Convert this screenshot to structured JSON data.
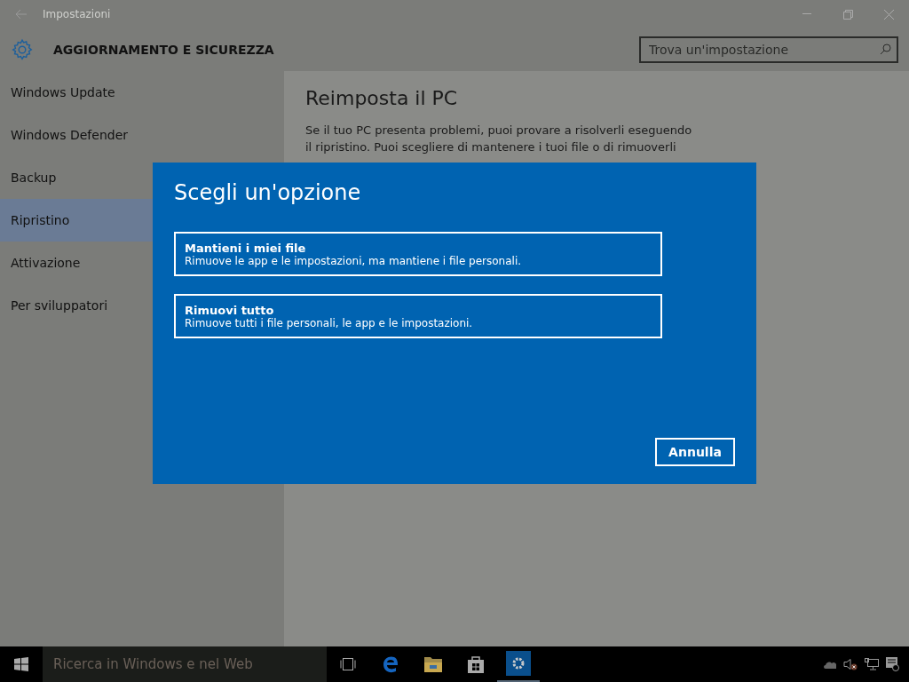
{
  "window": {
    "title": "Impostazioni"
  },
  "header": {
    "title": "AGGIORNAMENTO E SICUREZZA",
    "search": {
      "placeholder": "Trova un'impostazione"
    }
  },
  "sidebar": {
    "items": [
      {
        "label": "Windows Update",
        "selected": false
      },
      {
        "label": "Windows Defender",
        "selected": false
      },
      {
        "label": "Backup",
        "selected": false
      },
      {
        "label": "Ripristino",
        "selected": true
      },
      {
        "label": "Attivazione",
        "selected": false
      },
      {
        "label": "Per sviluppatori",
        "selected": false
      }
    ]
  },
  "content": {
    "title": "Reimposta il PC",
    "paragraph_lines": [
      "Se il tuo PC presenta problemi, puoi provare a risolverli eseguendo",
      "il ripristino. Puoi scegliere di mantenere i tuoi file o di rimuoverli"
    ]
  },
  "dialog": {
    "title": "Scegli un'opzione",
    "options": [
      {
        "title": "Mantieni i miei file",
        "description": "Rimuove le app e le impostazioni, ma mantiene i file personali."
      },
      {
        "title": "Rimuovi tutto",
        "description": "Rimuove tutti i file personali, le app e le impostazioni."
      }
    ],
    "cancel": "Annulla"
  },
  "taskbar": {
    "search": {
      "placeholder": "Ricerca in Windows e nel Web"
    }
  }
}
